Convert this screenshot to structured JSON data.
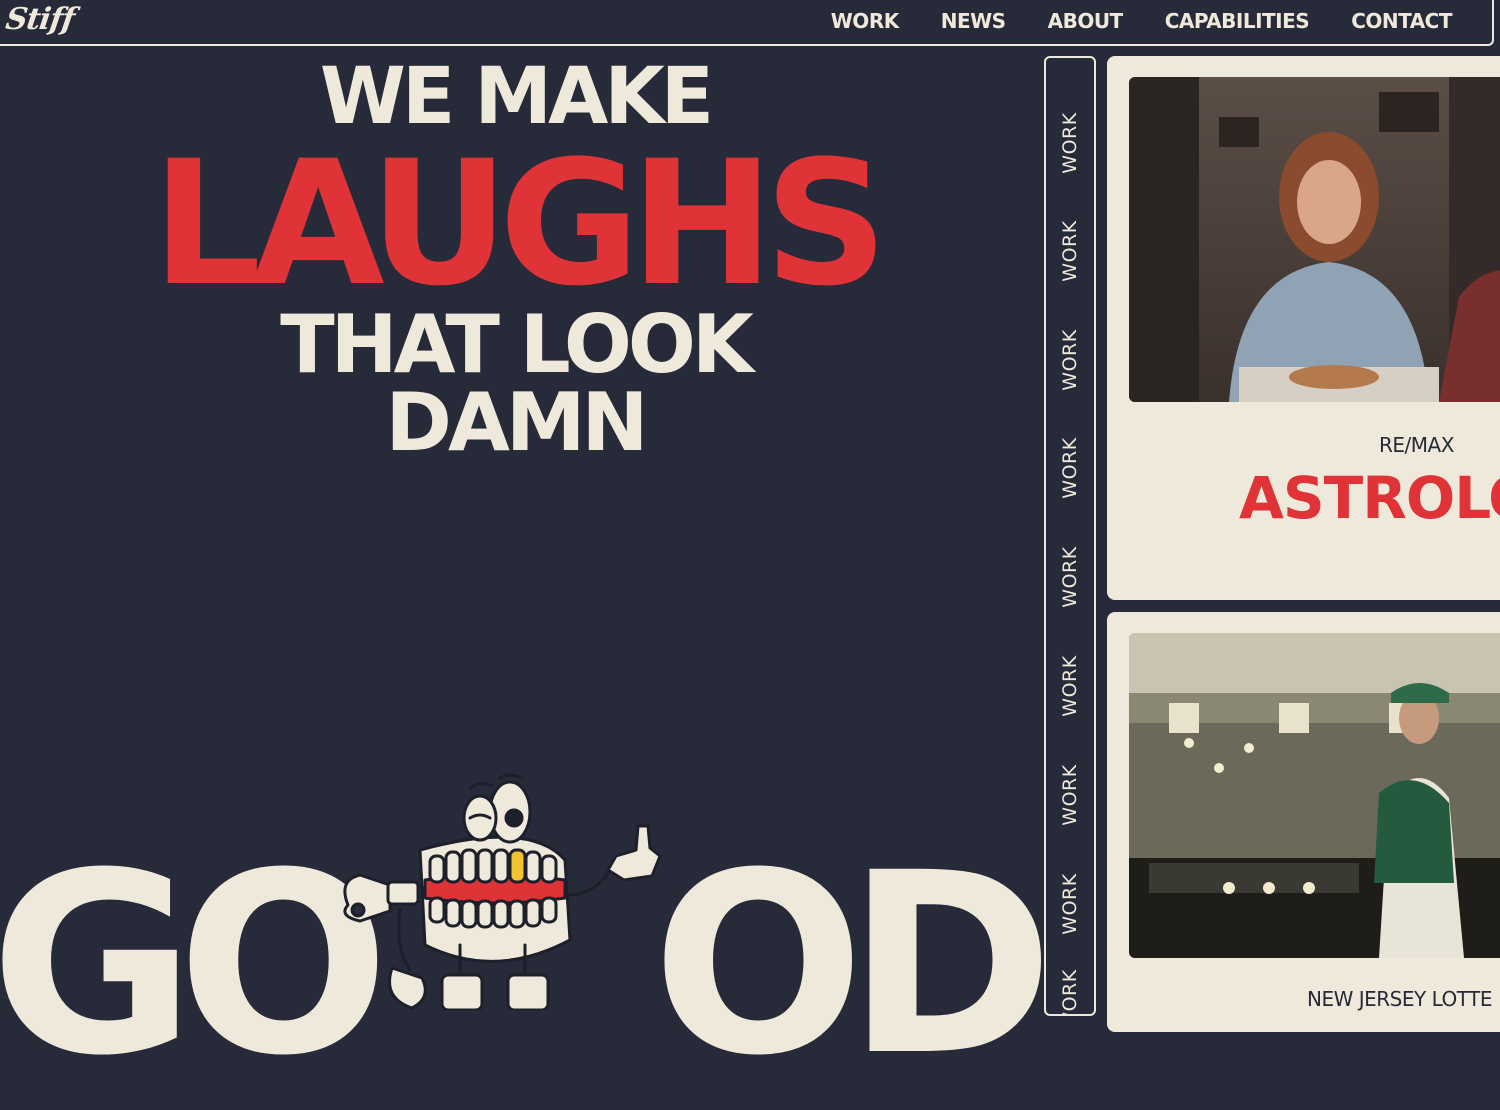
{
  "header": {
    "logo": "Stiff",
    "nav": [
      "WORK",
      "NEWS",
      "ABOUT",
      "CAPABILITIES",
      "CONTACT"
    ]
  },
  "hero": {
    "line1": "WE MAKE",
    "line2": "LAUGHS",
    "line3": "THAT LOOK",
    "line4": "DAMN",
    "good_left": "GO",
    "good_right": "OD"
  },
  "rail": {
    "label": "WORK"
  },
  "cards": [
    {
      "client": "RE/MAX",
      "project": "ASTROLO"
    },
    {
      "client": "NEW JERSEY LOTTE",
      "project": ""
    }
  ],
  "colors": {
    "background": "#272a38",
    "cream": "#efe9dc",
    "red": "#e03337"
  }
}
